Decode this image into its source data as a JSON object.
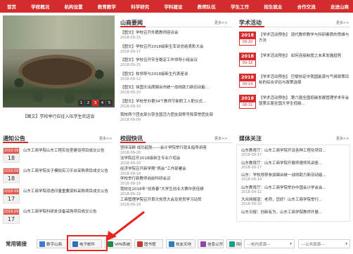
{
  "nav": [
    "首页",
    "学校概况",
    "机构设置",
    "教育教学",
    "科学研究",
    "学科建设",
    "教师队伍",
    "学生工作",
    "招生就业",
    "合作交流",
    "走进山商"
  ],
  "slideshow": {
    "caption": "【图文】学校举行应征入伍学生欢送会",
    "pages": [
      "1",
      "2",
      "3",
      "4",
      "5"
    ],
    "active": 2
  },
  "news": {
    "title": "山商要闻",
    "more": "更多>>",
    "items": [
      {
        "t": "【图文】学校召开外籍教师座谈会",
        "d": "2018-09-15"
      },
      {
        "t": "【图文】学校召开2018级新生军训总结表彰大会",
        "d": "2018-09-17"
      },
      {
        "t": "【图文】学校召开安全稳定工作领导小组会议",
        "d": "2018-09-15"
      },
      {
        "t": "【图文】校领导与2018级新生代表座谈",
        "d": "2018-09-12"
      },
      {
        "t": "【图文】徐国文出席烟台市统一战线助力新旧动能...",
        "d": "2018-09-10"
      },
      {
        "t": "【图文】学校举办第34个教师节新职工入职仪式...",
        "d": "2018-09-10"
      },
      {
        "t": "我校两个团支部分获全国活力团支部称号和荣誉团支部",
        "d": "2018-09-09"
      }
    ]
  },
  "academic": {
    "title": "学术活动",
    "more": "更多>>",
    "items": [
      {
        "y": "2018",
        "md": "09-20",
        "t": "【学术活动预告】 现代教师教学与科研素质的思维与方法"
      },
      {
        "y": "2018",
        "md": "09-18",
        "t": "【学术活动预告】 如何连接制度之未来发展趋势"
      },
      {
        "y": "2018",
        "md": "09-14",
        "t": "【学术活动预告】 巴黎协定中我国能源与气候政策目标的综合评估与政策选择"
      },
      {
        "y": "2018",
        "md": "08-31",
        "t": "【学术活动预告】 第六届全国低碳发展管理学术年会暨第五届全国大学生低碳..."
      }
    ]
  },
  "notices": {
    "title": "通知公告",
    "more": "更多>>",
    "items": [
      {
        "ym": "2018-09",
        "dd": "18",
        "t": "山东工商学院山东工程实验室建设项目成交公告"
      },
      {
        "ym": "2018-09",
        "dd": "18",
        "t": "山东工商学院关于模拟实习平台采购项目成交公告"
      },
      {
        "ym": "2018-09",
        "dd": "17",
        "t": "山东工商学院双语印量重要资料采购项目成交公告"
      },
      {
        "ym": "2018-09",
        "dd": "17",
        "t": "山东工商学院科研处设备采购项目成交公告"
      }
    ]
  },
  "campus": {
    "title": "校园快讯",
    "more": "更多>>",
    "items": [
      {
        "t": "坚持深耕 成功起航——会计学院举行就业指导讲座",
        "d": "2018-09-20"
      },
      {
        "t": "法学院召开2018级新生专业介绍会",
        "d": "2018-09-20"
      },
      {
        "t": "经济学院召开新学期“两会”工作部署会",
        "d": "2018-09-19"
      },
      {
        "t": "学校举行新教师岗前科研会议",
        "d": "2018-09-19"
      },
      {
        "t": "我校在2018年“创青春”大学生创业大赛中获佳绩",
        "d": "2018-09-19"
      },
      {
        "t": "工商管理学院召开首次党员大会及党员学习动员",
        "d": "2018-09-19"
      }
    ]
  },
  "media": {
    "title": "媒体关注",
    "more": "更多>>",
    "items": [
      {
        "t": "山东教育厅：山东工商学院开设各种工程化项目...",
        "d": "2018-09-17"
      },
      {
        "t": "山东教育厅：山东工商学院开展师德师风讲座...",
        "d": "2018-09-17"
      },
      {
        "t": "山东：学校领导参加烟台统一战线助力新旧动能...",
        "d": "2018-09-14"
      },
      {
        "t": "山东教育厅：山东工商学院举办中国会计学会会...",
        "d": "2018-09-12"
      },
      {
        "t": "大众网报道：老师，您好！山东工商学院举行...",
        "d": "2018-09-10"
      },
      {
        "t": "山东日报：创新有为，山东工商学院教师开展..."
      }
    ]
  },
  "links": {
    "label": "常用链接",
    "buttons": [
      {
        "label": "数字山商",
        "color": "#3a7bd5"
      },
      {
        "label": "电子邮件",
        "color": "#2d6fb8"
      },
      {
        "label": "VPN系统",
        "color": "#1e8a4a"
      },
      {
        "label": "图书馆",
        "color": "#c0392b"
      },
      {
        "label": "校友天地",
        "color": "#2980b9"
      },
      {
        "label": "信息公开",
        "color": "#8e44ad"
      },
      {
        "label": "网络教校",
        "color": "#16a085"
      }
    ],
    "selects": [
      "---校内资源---",
      "---公共资源---"
    ]
  }
}
